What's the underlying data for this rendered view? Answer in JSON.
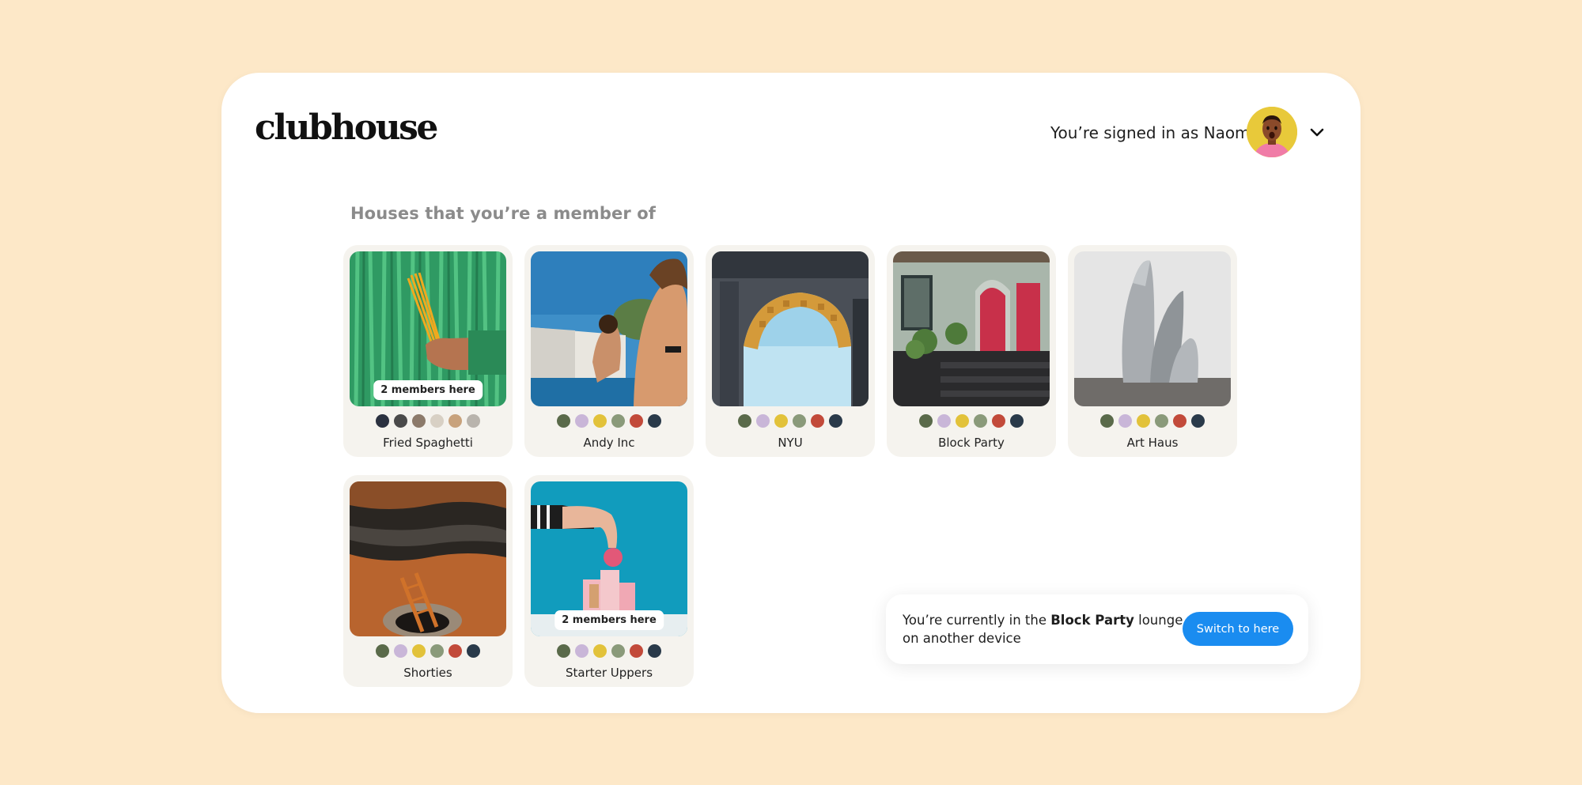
{
  "app": {
    "logo_text": "clubhouse",
    "signed_in_text": "You’re signed in as Naomi",
    "avatar_icon": "user-avatar"
  },
  "section_title": "Houses that you’re a member of",
  "houses": [
    {
      "name": "Fried Spaghetti",
      "badge": "2 members here"
    },
    {
      "name": "Andy Inc",
      "badge": ""
    },
    {
      "name": "NYU",
      "badge": ""
    },
    {
      "name": "Block Party",
      "badge": ""
    },
    {
      "name": "Art Haus",
      "badge": ""
    },
    {
      "name": "Shorties",
      "badge": ""
    },
    {
      "name": "Starter Uppers",
      "badge": "2 members here"
    }
  ],
  "toast": {
    "prefix": "You’re currently in the ",
    "house": "Block Party",
    "suffix": " lounge on another device",
    "button_label": "Switch to here"
  },
  "colors": {
    "page_bg": "#fde8c8",
    "card_bg": "#f5f3ee",
    "accent": "#1a8cf0"
  }
}
